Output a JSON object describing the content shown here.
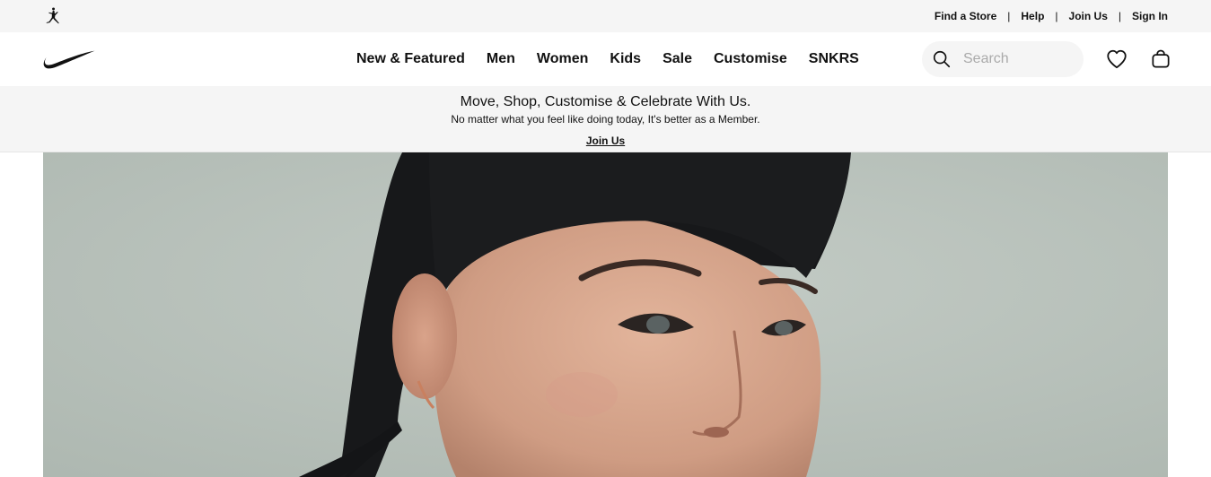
{
  "utility_bar": {
    "links": [
      "Find a Store",
      "Help",
      "Join Us",
      "Sign In"
    ],
    "separator": "|"
  },
  "nav": {
    "items": [
      "New & Featured",
      "Men",
      "Women",
      "Kids",
      "Sale",
      "Customise",
      "SNKRS"
    ]
  },
  "search": {
    "placeholder": "Search"
  },
  "icons": {
    "utility_logo": "jordan-jumpman-icon",
    "brand_logo": "nike-swoosh-icon",
    "search": "search-icon",
    "favourites": "heart-icon",
    "bag": "bag-icon"
  },
  "promo": {
    "title": "Move, Shop, Customise & Celebrate With Us.",
    "subtitle": "No matter what you feel like doing today, It's better as a Member.",
    "link": "Join Us"
  },
  "colors": {
    "utility_bg": "#f5f5f5",
    "text": "#111111",
    "hero_bg": "#b9c2bc"
  }
}
